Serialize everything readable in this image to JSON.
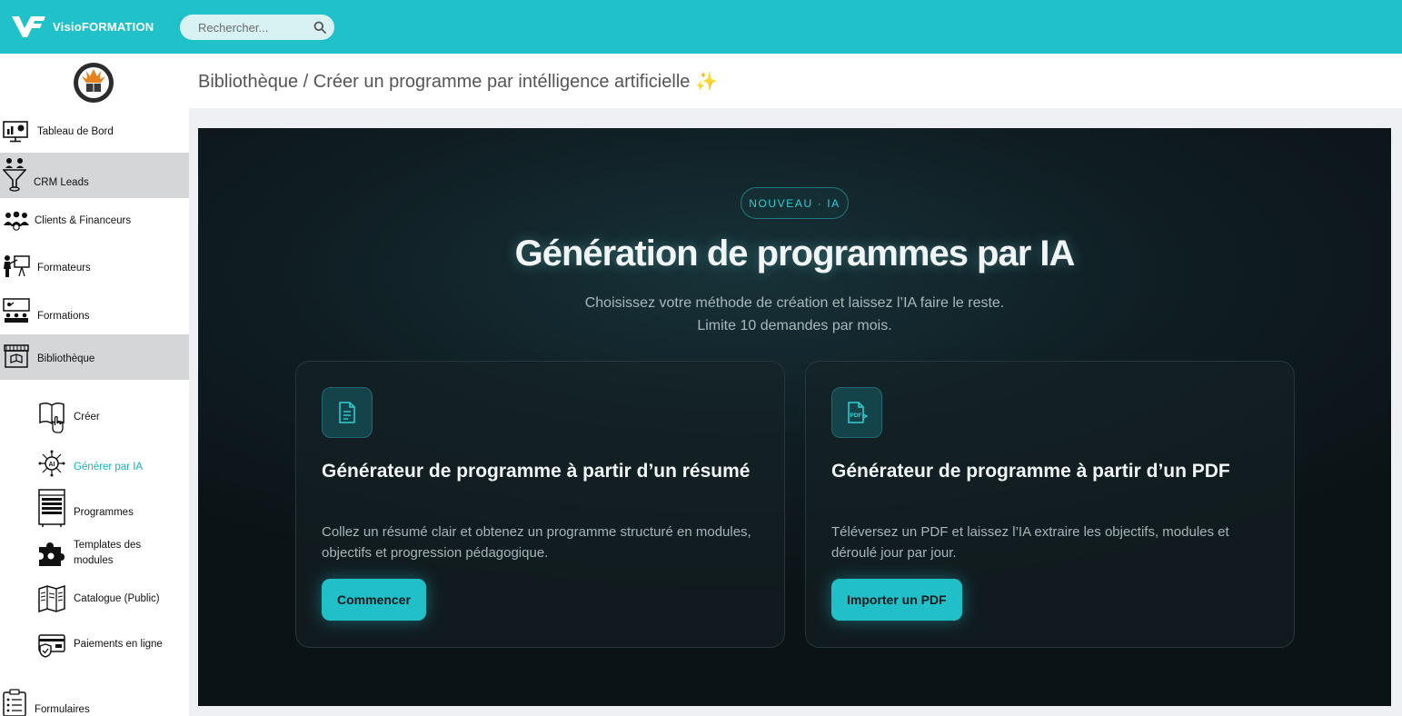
{
  "app": {
    "brand_name": "VisioFORMATION",
    "brand_logo_icon": "vf-logo-icon"
  },
  "search": {
    "placeholder": "Rechercher...",
    "icon": "search-icon"
  },
  "colors": {
    "topbar": "#21c1c9",
    "accent": "#21bfc7",
    "active_link": "#16b3bd",
    "hero_bg": "#0f1d22",
    "sidebar_active": "#d4d6d7"
  },
  "sidebar": {
    "logo_icon": "organization-seal-icon",
    "items": [
      {
        "label": "Tableau de Bord",
        "icon": "dashboard-monitor-icon",
        "active": false
      },
      {
        "label": "CRM Leads",
        "icon": "funnel-people-icon",
        "active": true
      },
      {
        "label": "Clients & Financeurs",
        "icon": "people-group-icon",
        "active": false
      },
      {
        "label": "Formateurs",
        "icon": "trainer-board-icon",
        "active": false
      },
      {
        "label": "Formations",
        "icon": "classroom-icon",
        "active": false
      },
      {
        "label": "Bibliothèque",
        "icon": "library-store-icon",
        "active": true
      },
      {
        "label": "Formulaires",
        "icon": "clipboard-list-icon",
        "active": false
      }
    ],
    "subitems": [
      {
        "label": "Créer",
        "icon": "book-hand-icon",
        "current": false
      },
      {
        "label": "Générer par IA",
        "icon": "ai-chip-icon",
        "current": true
      },
      {
        "label": "Programmes",
        "icon": "schedule-grid-icon",
        "current": false
      },
      {
        "label": "Templates des modules",
        "icon": "puzzle-icon",
        "current": false
      },
      {
        "label": "Catalogue (Public)",
        "icon": "brochure-icon",
        "current": false
      },
      {
        "label": "Paiements en ligne",
        "icon": "secure-card-icon",
        "current": false
      }
    ]
  },
  "breadcrumb": {
    "text": "Bibliothèque / Créer un programme par intélligence artificielle",
    "sparkle": "✨"
  },
  "hero": {
    "badge": "NOUVEAU · IA",
    "title": "Génération de programmes par IA",
    "subtitle_line1": "Choisissez votre méthode de création et laissez l’IA faire le reste.",
    "subtitle_line2": "Limite 10 demandes par mois."
  },
  "cards": [
    {
      "icon": "document-icon",
      "title": "Générateur de programme à partir d’un résumé",
      "description": "Collez un résumé clair et obtenez un programme structuré en modules, objectifs et progression pédagogique.",
      "button": "Commencer"
    },
    {
      "icon": "pdf-file-icon",
      "title": "Générateur de programme à partir d’un PDF",
      "description": "Téléversez un PDF et laissez l’IA extraire les objectifs, modules et déroulé jour par jour.",
      "button": "Importer un PDF"
    }
  ]
}
